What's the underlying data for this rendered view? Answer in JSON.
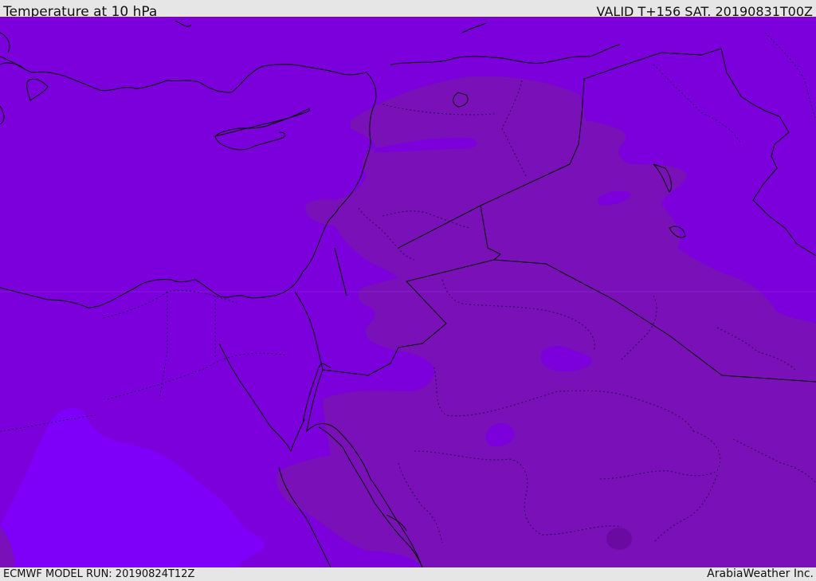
{
  "header": {
    "title": "Temperature at 10 hPa",
    "valid": "VALID T+156 SAT. 20190831T00Z"
  },
  "footer": {
    "model_run": "ECMWF MODEL RUN: 20190824T12Z",
    "credit": "ArabiaWeather Inc."
  },
  "colors": {
    "field_base": "#7b00db",
    "field_warm": "#7a10b8",
    "field_cool": "#7e00f8",
    "field_spot": "#6a0aa0",
    "coastline": "#000000"
  }
}
